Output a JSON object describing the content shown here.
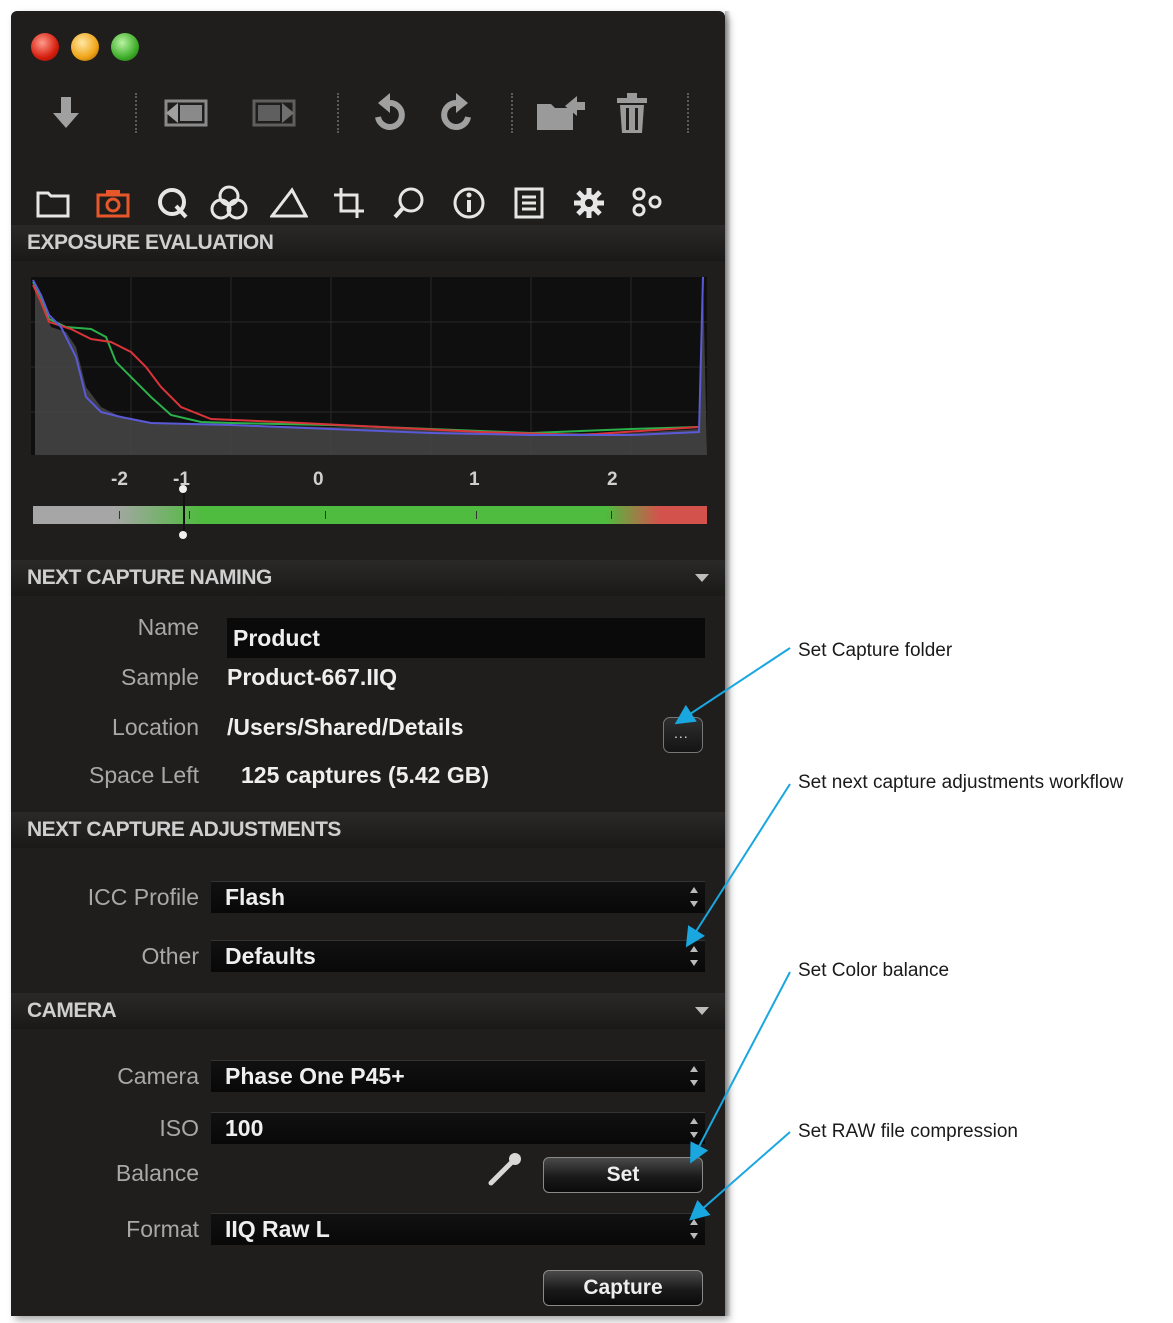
{
  "sections": {
    "exposure": "EXPOSURE EVALUATION",
    "naming": "NEXT CAPTURE NAMING",
    "adjustments": "NEXT CAPTURE ADJUSTMENTS",
    "camera": "CAMERA"
  },
  "exposure_scale": [
    "-2",
    "-1",
    "0",
    "1",
    "2"
  ],
  "exposure_marker_ev": -1,
  "naming": {
    "name_label": "Name",
    "name_value": "Product",
    "sample_label": "Sample",
    "sample_value": "Product-667.IIQ",
    "location_label": "Location",
    "location_value": "/Users/Shared/Details",
    "space_label": "Space Left",
    "space_value": "125 captures (5.42 GB)",
    "location_button": "..."
  },
  "adjustments": {
    "icc_label": "ICC Profile",
    "icc_value": "Flash",
    "other_label": "Other",
    "other_value": "Defaults"
  },
  "camera": {
    "camera_label": "Camera",
    "camera_value": "Phase One P45+",
    "iso_label": "ISO",
    "iso_value": "100",
    "balance_label": "Balance",
    "set_button": "Set",
    "format_label": "Format",
    "format_value": "IIQ Raw L",
    "capture_button": "Capture"
  },
  "annotations": {
    "capture_folder": "Set Capture folder",
    "adjustments_workflow": "Set next capture adjustments workflow",
    "color_balance": "Set Color balance",
    "raw_compression": "Set RAW file compression"
  },
  "colors": {
    "accent_tab": "#e8572a",
    "annotation_arrow": "#1aa7e0"
  },
  "icons": [
    "import-arrow-icon",
    "previous-capture-icon",
    "next-capture-icon",
    "rotate-left-icon",
    "rotate-right-icon",
    "move-folder-icon",
    "trash-icon",
    "library-tab-icon",
    "capture-tab-icon",
    "quick-tab-icon",
    "color-tab-icon",
    "exposure-tab-icon",
    "crop-tab-icon",
    "focus-tab-icon",
    "metadata-tab-icon",
    "output-tab-icon",
    "settings-tab-icon",
    "batch-tab-icon"
  ]
}
